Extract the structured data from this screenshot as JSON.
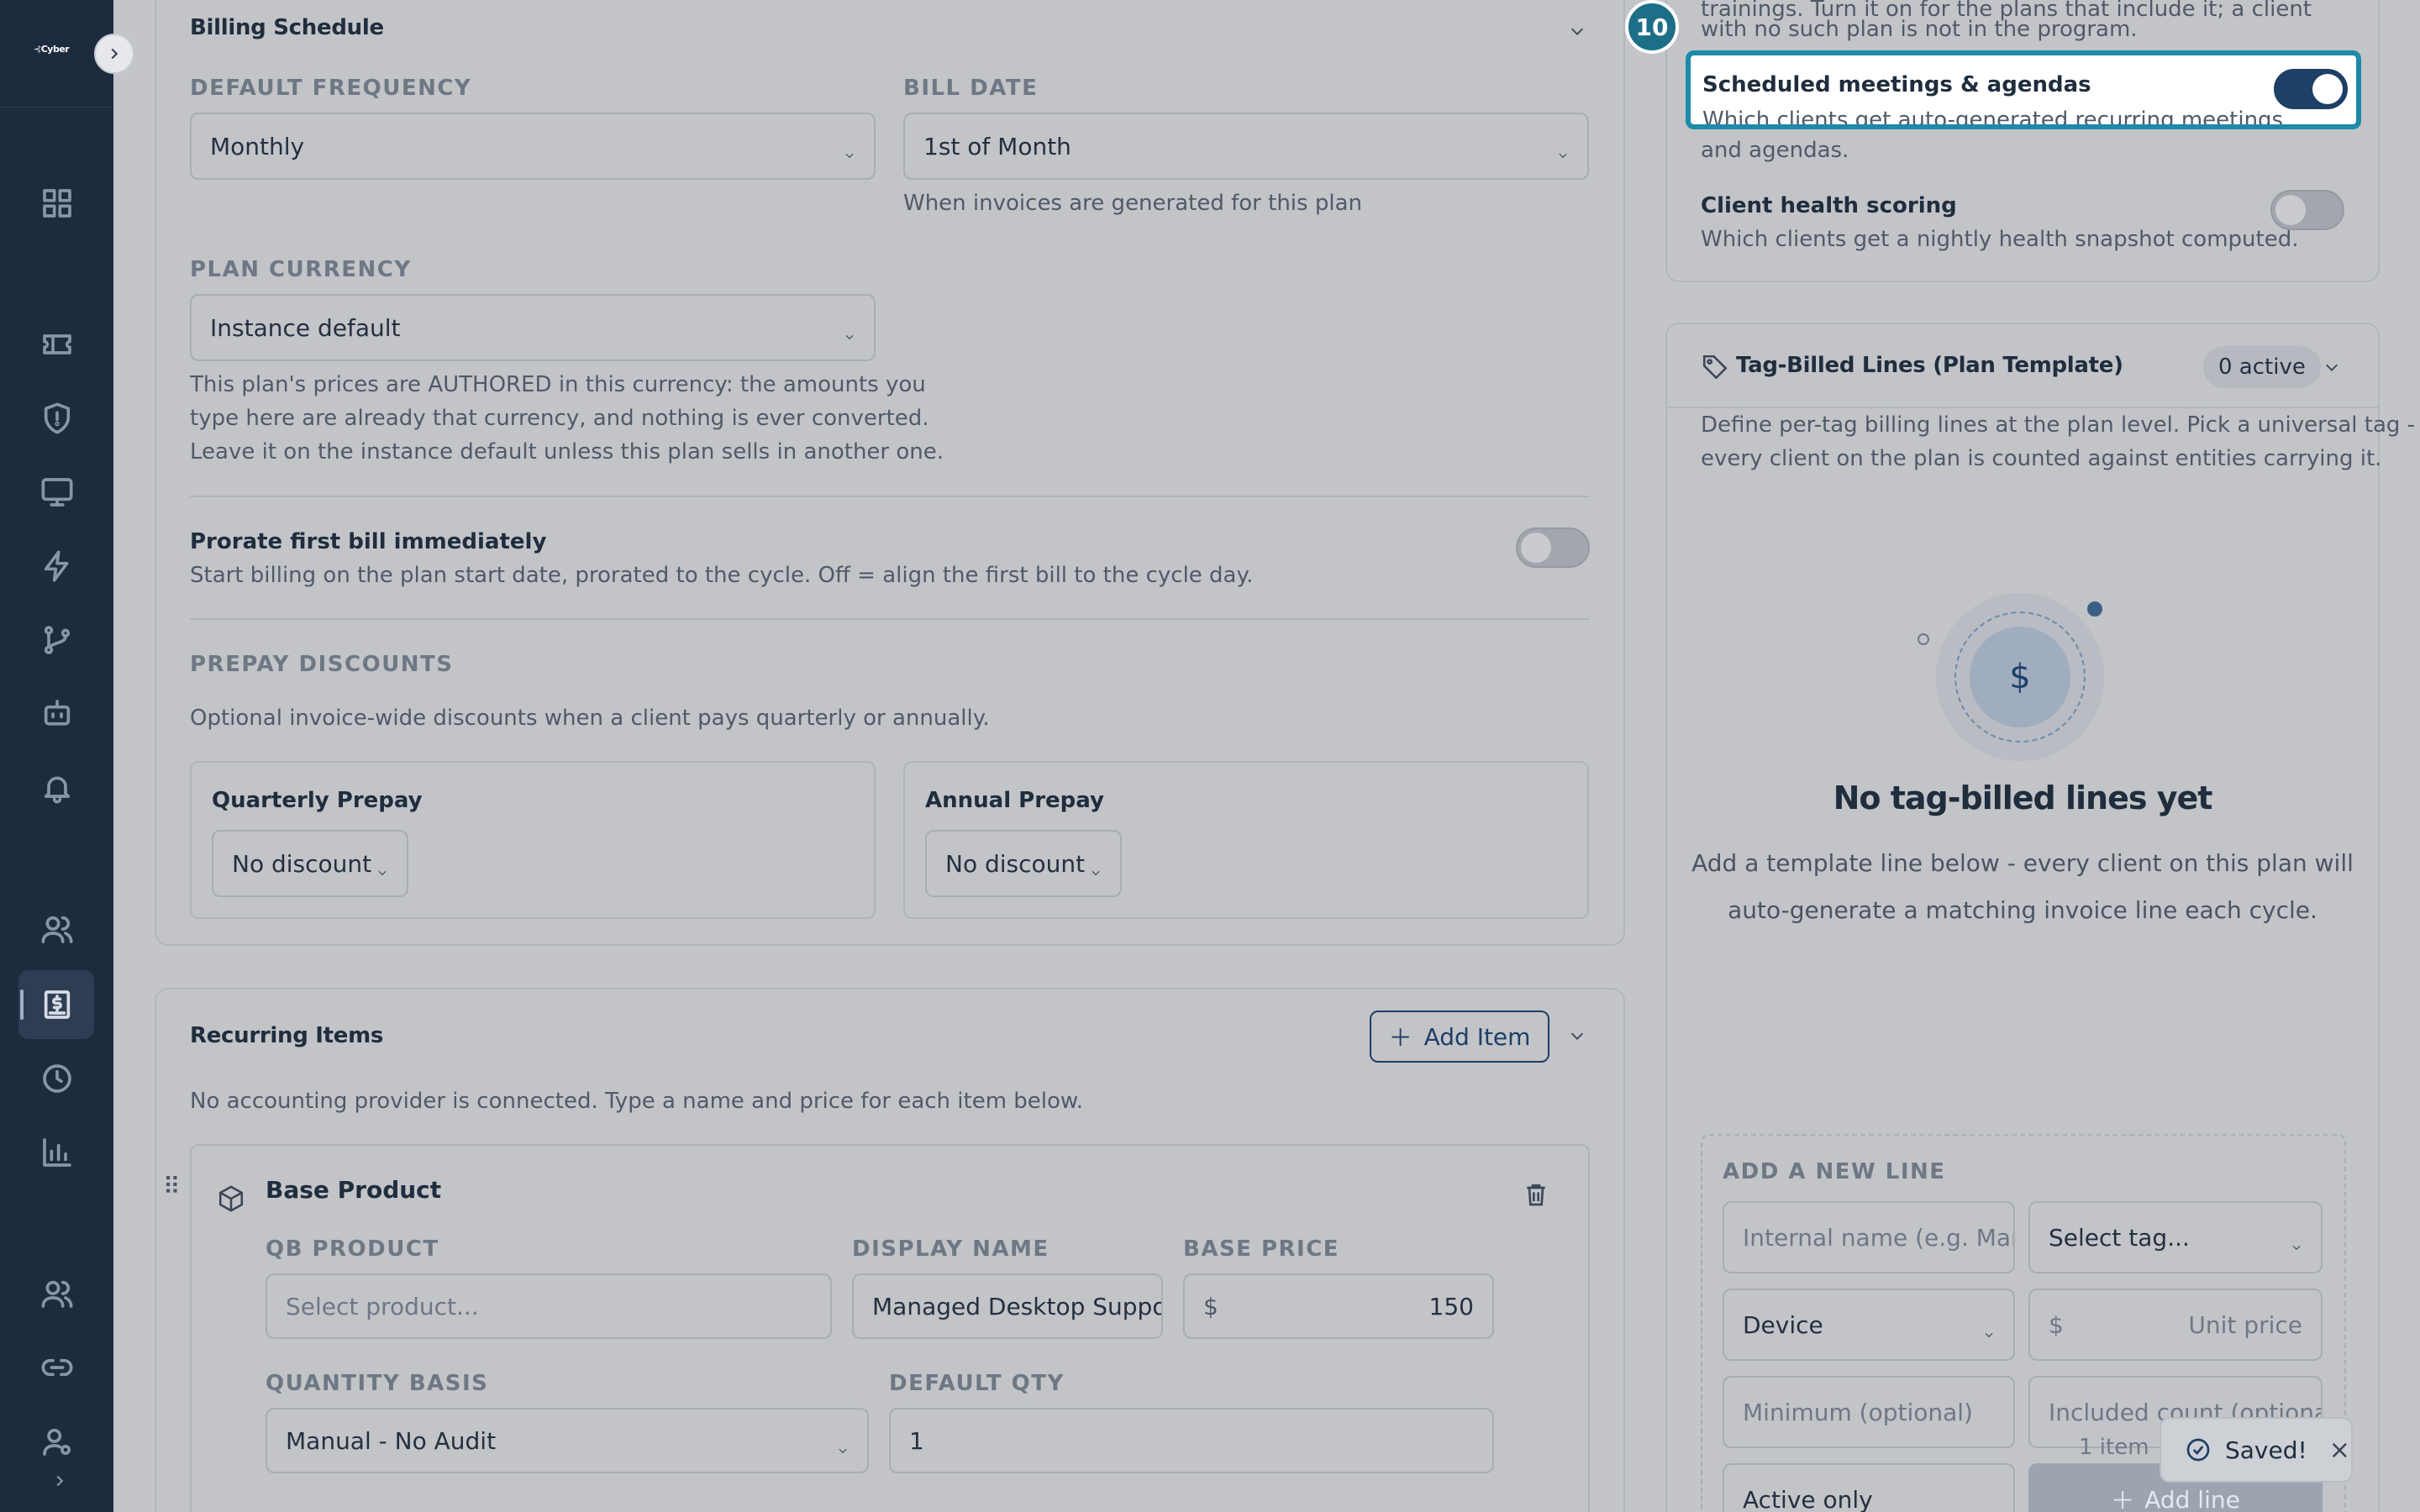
{
  "sidebar": {
    "logo_text": "Cyber",
    "expand_icon": "chevron-right-icon",
    "items": [
      {
        "name": "dashboard",
        "icon": "grid-icon"
      },
      {
        "name": "tickets",
        "icon": "ticket-icon"
      },
      {
        "name": "security",
        "icon": "shield-icon"
      },
      {
        "name": "devices",
        "icon": "monitor-icon"
      },
      {
        "name": "automation",
        "icon": "lightning-icon"
      },
      {
        "name": "workflows",
        "icon": "branch-icon"
      },
      {
        "name": "ai-agent",
        "icon": "robot-icon"
      },
      {
        "name": "alerts",
        "icon": "bell-icon"
      },
      {
        "name": "clients",
        "icon": "users-icon"
      },
      {
        "name": "billing",
        "icon": "invoice-icon",
        "active": true
      },
      {
        "name": "time",
        "icon": "clock-icon"
      },
      {
        "name": "reports",
        "icon": "bar-chart-icon"
      },
      {
        "name": "team",
        "icon": "team-icon"
      },
      {
        "name": "integrations",
        "icon": "link-icon"
      },
      {
        "name": "admin",
        "icon": "user-settings-icon"
      }
    ]
  },
  "billing_schedule": {
    "title": "Billing Schedule",
    "default_frequency_label": "DEFAULT FREQUENCY",
    "default_frequency_value": "Monthly",
    "bill_date_label": "BILL DATE",
    "bill_date_value": "1st of Month",
    "bill_date_help": "When invoices are generated for this plan",
    "plan_currency_label": "PLAN CURRENCY",
    "plan_currency_value": "Instance default",
    "plan_currency_help": [
      "This plan's prices are AUTHORED in this currency: the amounts you",
      "type here are already that currency, and nothing is ever converted.",
      "Leave it on the instance default unless this plan sells in another one."
    ],
    "prorate_title": "Prorate first bill immediately",
    "prorate_desc": "Start billing on the plan start date, prorated to the cycle. Off = align the first bill to the cycle day.",
    "prorate_on": false,
    "prepay_label": "PREPAY DISCOUNTS",
    "prepay_desc": "Optional invoice-wide discounts when a client pays quarterly or annually.",
    "quarterly_title": "Quarterly Prepay",
    "quarterly_value": "No discount",
    "annual_title": "Annual Prepay",
    "annual_value": "No discount"
  },
  "recurring_items": {
    "title": "Recurring Items",
    "add_item_label": "Add Item",
    "note": "No accounting provider is connected. Type a name and price for each item below.",
    "item": {
      "title": "Base Product",
      "qb_product_label": "QB PRODUCT",
      "qb_product_placeholder": "Select product...",
      "display_name_label": "DISPLAY NAME",
      "display_name_value": "Managed Desktop Support",
      "base_price_label": "BASE PRICE",
      "currency_symbol": "$",
      "base_price_value": "150",
      "quantity_basis_label": "QUANTITY BASIS",
      "quantity_basis_value": "Manual - No Audit",
      "default_qty_label": "DEFAULT QTY",
      "default_qty_value": "1"
    }
  },
  "features_panel": {
    "top_text_1": "trainings. Turn it on for the plans that include it; a client",
    "top_text_2": "with no such plan is not in the program.",
    "step_badge": "10",
    "meetings_title": "Scheduled meetings & agendas",
    "meetings_desc_1": "Which clients get auto-generated recurring meetings",
    "meetings_desc_2": "and agendas.",
    "meetings_on": true,
    "health_title": "Client health scoring",
    "health_desc": "Which clients get a nightly health snapshot computed.",
    "health_on": false
  },
  "tag_billed": {
    "title": "Tag-Billed Lines (Plan Template)",
    "active_badge": "0 active",
    "description_1": "Define per-tag billing lines at the plan level. Pick a universal tag -",
    "description_2": "every client on the plan is counted against entities carrying it.",
    "empty_symbol": "$",
    "empty_title": "No tag-billed lines yet",
    "empty_desc_1": "Add a template line below - every client on this plan will",
    "empty_desc_2": "auto-generate a matching invoice line each cycle.",
    "add_new_label": "ADD A NEW LINE",
    "internal_name_placeholder": "Internal name (e.g. Managed",
    "select_tag_placeholder": "Select tag...",
    "entity_type_value": "Device",
    "currency_symbol": "$",
    "unit_price_placeholder": "Unit price",
    "minimum_placeholder": "Minimum (optional)",
    "included_placeholder": "Included count (optional)",
    "count_hint": "1 item",
    "scope_value": "Active only",
    "add_line_label": "Add line"
  },
  "toast": {
    "message": "Saved!"
  }
}
